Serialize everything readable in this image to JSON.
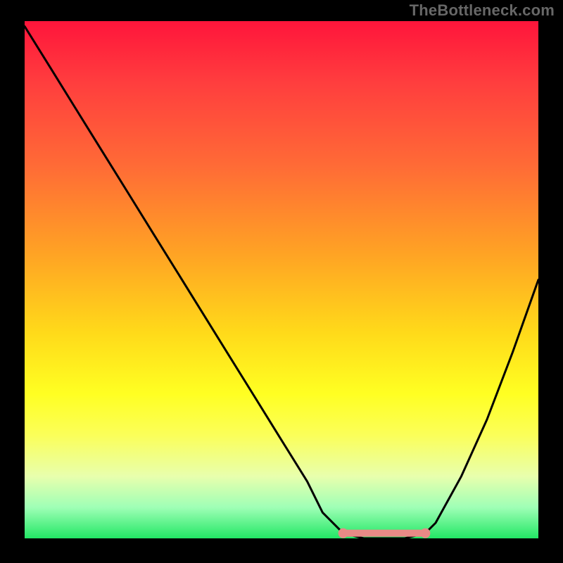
{
  "watermark": "TheBottleneck.com",
  "chart_data": {
    "type": "line",
    "title": "",
    "xlabel": "",
    "ylabel": "",
    "xlim": [
      0,
      100
    ],
    "ylim": [
      0,
      100
    ],
    "grid": false,
    "legend": false,
    "series": [
      {
        "name": "bottleneck-curve",
        "color": "#000000",
        "x": [
          0,
          5,
          10,
          15,
          20,
          25,
          30,
          35,
          40,
          45,
          50,
          55,
          58,
          62,
          66,
          70,
          74,
          78,
          80,
          85,
          90,
          95,
          100
        ],
        "y": [
          99,
          91,
          83,
          75,
          67,
          59,
          51,
          43,
          35,
          27,
          19,
          11,
          5,
          1,
          0,
          0,
          0,
          1,
          3,
          12,
          23,
          36,
          50
        ]
      }
    ],
    "flat_region": {
      "x_start": 62,
      "x_end": 78,
      "marker_color": "#e88a86"
    },
    "colors": {
      "gradient_top": "#ff153b",
      "gradient_bottom": "#22e765",
      "background": "#000000"
    }
  }
}
